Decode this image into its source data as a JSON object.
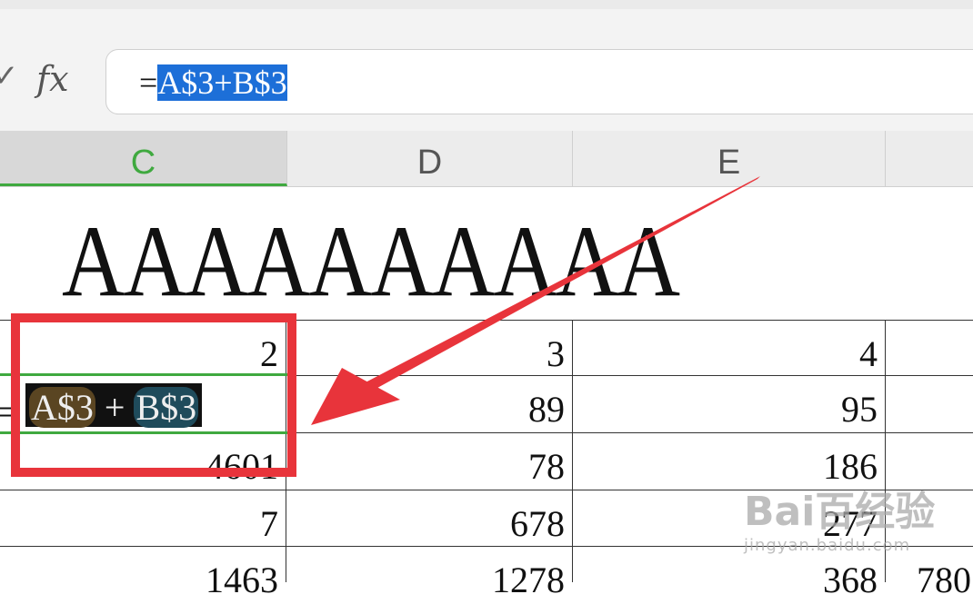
{
  "formula_bar": {
    "check_icon": "check-icon",
    "fx_label": "fx",
    "formula_prefix": "=",
    "formula_selected": "A$3+B$3"
  },
  "columns": [
    {
      "label": "C",
      "active": true
    },
    {
      "label": "D",
      "active": false
    },
    {
      "label": "E",
      "active": false
    }
  ],
  "title_text": "AAAAAAAAAA",
  "rows": [
    {
      "c": "2",
      "d": "3",
      "e": "4",
      "f": ""
    },
    {
      "c": "",
      "d": "89",
      "e": "95",
      "f": ""
    },
    {
      "c": "4601",
      "d": "78",
      "e": "186",
      "f": ""
    },
    {
      "c": "7",
      "d": "678",
      "e": "277",
      "f": ""
    },
    {
      "c": "1463",
      "d": "1278",
      "e": "368",
      "f": "780"
    }
  ],
  "edit_cell": {
    "eq": "=",
    "ref1": "A$3",
    "op": " + ",
    "ref2": "B$3"
  },
  "colors": {
    "highlight": "#e8343b",
    "selection": "#1d6fd8",
    "active_column": "#3fa93f"
  },
  "watermark": {
    "main": "Bai百经验",
    "sub": "jingyan.baidu.com"
  }
}
